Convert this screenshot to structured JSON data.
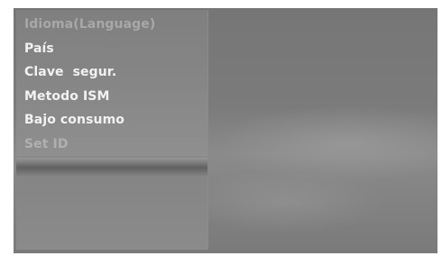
{
  "menu": {
    "items": [
      {
        "label": "Idioma(Language)",
        "state": "dim"
      },
      {
        "label": "País",
        "state": "normal"
      },
      {
        "label": "Clave  segur.",
        "state": "normal"
      },
      {
        "label": "Metodo ISM",
        "state": "normal"
      },
      {
        "label": "Bajo consumo",
        "state": "normal"
      },
      {
        "label": "Set ID",
        "state": "disabled"
      }
    ]
  },
  "colors": {
    "menu_text": "#f2f2f2",
    "menu_text_dim": "#a8a8a8",
    "background": "#7b7b7b"
  }
}
